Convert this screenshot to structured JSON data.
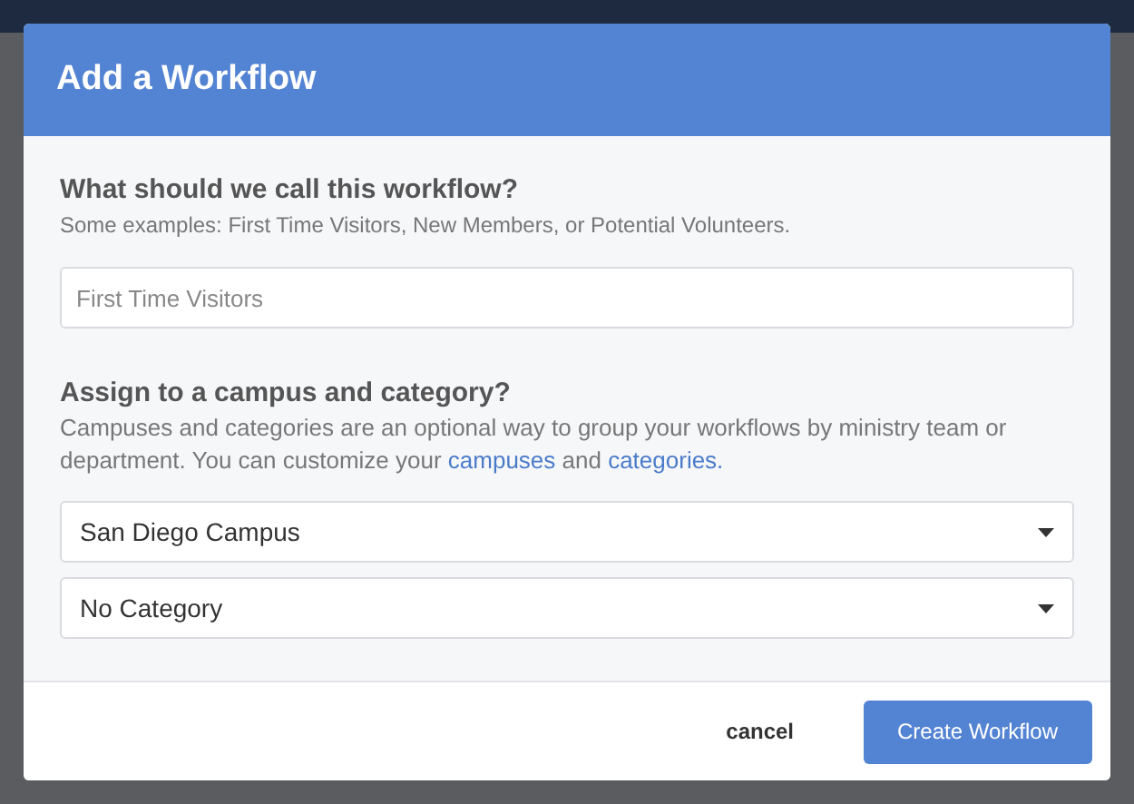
{
  "dialog": {
    "title": "Add a Workflow",
    "name_section": {
      "heading": "What should we call this workflow?",
      "hint": "Some examples: First Time Visitors, New Members, or Potential Volunteers.",
      "field": {
        "placeholder": "First Time Visitors"
      }
    },
    "assign_section": {
      "heading": "Assign to a campus and category?",
      "description": [
        {
          "kind": "text",
          "text": "Campuses and categories are an optional way to group your workflows by ministry team or department. You can customize your "
        },
        {
          "kind": "link",
          "text": "campuses"
        },
        {
          "kind": "text",
          "text": " and "
        },
        {
          "kind": "link",
          "text": "categories."
        }
      ],
      "selects": [
        {
          "value": "San Diego Campus"
        },
        {
          "value": "No Category"
        }
      ]
    },
    "buttons": [
      {
        "kind": "text",
        "label": "cancel"
      },
      {
        "kind": "primary",
        "label": "Create Workflow"
      }
    ]
  }
}
